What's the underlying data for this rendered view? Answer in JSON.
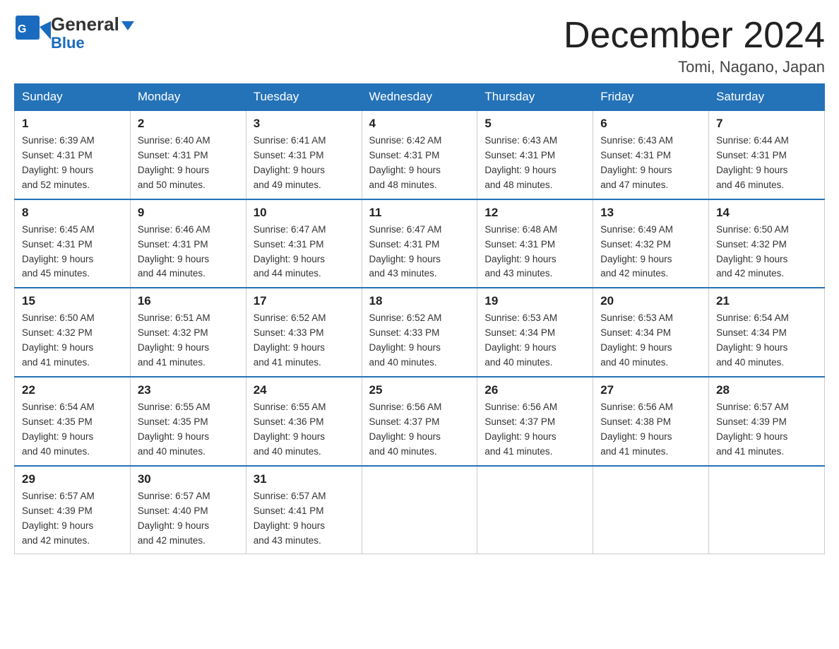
{
  "header": {
    "logo_general": "General",
    "logo_blue": "Blue",
    "month_year": "December 2024",
    "location": "Tomi, Nagano, Japan"
  },
  "weekdays": [
    "Sunday",
    "Monday",
    "Tuesday",
    "Wednesday",
    "Thursday",
    "Friday",
    "Saturday"
  ],
  "weeks": [
    [
      {
        "day": "1",
        "sunrise": "Sunrise: 6:39 AM",
        "sunset": "Sunset: 4:31 PM",
        "daylight": "Daylight: 9 hours",
        "daylight2": "and 52 minutes."
      },
      {
        "day": "2",
        "sunrise": "Sunrise: 6:40 AM",
        "sunset": "Sunset: 4:31 PM",
        "daylight": "Daylight: 9 hours",
        "daylight2": "and 50 minutes."
      },
      {
        "day": "3",
        "sunrise": "Sunrise: 6:41 AM",
        "sunset": "Sunset: 4:31 PM",
        "daylight": "Daylight: 9 hours",
        "daylight2": "and 49 minutes."
      },
      {
        "day": "4",
        "sunrise": "Sunrise: 6:42 AM",
        "sunset": "Sunset: 4:31 PM",
        "daylight": "Daylight: 9 hours",
        "daylight2": "and 48 minutes."
      },
      {
        "day": "5",
        "sunrise": "Sunrise: 6:43 AM",
        "sunset": "Sunset: 4:31 PM",
        "daylight": "Daylight: 9 hours",
        "daylight2": "and 48 minutes."
      },
      {
        "day": "6",
        "sunrise": "Sunrise: 6:43 AM",
        "sunset": "Sunset: 4:31 PM",
        "daylight": "Daylight: 9 hours",
        "daylight2": "and 47 minutes."
      },
      {
        "day": "7",
        "sunrise": "Sunrise: 6:44 AM",
        "sunset": "Sunset: 4:31 PM",
        "daylight": "Daylight: 9 hours",
        "daylight2": "and 46 minutes."
      }
    ],
    [
      {
        "day": "8",
        "sunrise": "Sunrise: 6:45 AM",
        "sunset": "Sunset: 4:31 PM",
        "daylight": "Daylight: 9 hours",
        "daylight2": "and 45 minutes."
      },
      {
        "day": "9",
        "sunrise": "Sunrise: 6:46 AM",
        "sunset": "Sunset: 4:31 PM",
        "daylight": "Daylight: 9 hours",
        "daylight2": "and 44 minutes."
      },
      {
        "day": "10",
        "sunrise": "Sunrise: 6:47 AM",
        "sunset": "Sunset: 4:31 PM",
        "daylight": "Daylight: 9 hours",
        "daylight2": "and 44 minutes."
      },
      {
        "day": "11",
        "sunrise": "Sunrise: 6:47 AM",
        "sunset": "Sunset: 4:31 PM",
        "daylight": "Daylight: 9 hours",
        "daylight2": "and 43 minutes."
      },
      {
        "day": "12",
        "sunrise": "Sunrise: 6:48 AM",
        "sunset": "Sunset: 4:31 PM",
        "daylight": "Daylight: 9 hours",
        "daylight2": "and 43 minutes."
      },
      {
        "day": "13",
        "sunrise": "Sunrise: 6:49 AM",
        "sunset": "Sunset: 4:32 PM",
        "daylight": "Daylight: 9 hours",
        "daylight2": "and 42 minutes."
      },
      {
        "day": "14",
        "sunrise": "Sunrise: 6:50 AM",
        "sunset": "Sunset: 4:32 PM",
        "daylight": "Daylight: 9 hours",
        "daylight2": "and 42 minutes."
      }
    ],
    [
      {
        "day": "15",
        "sunrise": "Sunrise: 6:50 AM",
        "sunset": "Sunset: 4:32 PM",
        "daylight": "Daylight: 9 hours",
        "daylight2": "and 41 minutes."
      },
      {
        "day": "16",
        "sunrise": "Sunrise: 6:51 AM",
        "sunset": "Sunset: 4:32 PM",
        "daylight": "Daylight: 9 hours",
        "daylight2": "and 41 minutes."
      },
      {
        "day": "17",
        "sunrise": "Sunrise: 6:52 AM",
        "sunset": "Sunset: 4:33 PM",
        "daylight": "Daylight: 9 hours",
        "daylight2": "and 41 minutes."
      },
      {
        "day": "18",
        "sunrise": "Sunrise: 6:52 AM",
        "sunset": "Sunset: 4:33 PM",
        "daylight": "Daylight: 9 hours",
        "daylight2": "and 40 minutes."
      },
      {
        "day": "19",
        "sunrise": "Sunrise: 6:53 AM",
        "sunset": "Sunset: 4:34 PM",
        "daylight": "Daylight: 9 hours",
        "daylight2": "and 40 minutes."
      },
      {
        "day": "20",
        "sunrise": "Sunrise: 6:53 AM",
        "sunset": "Sunset: 4:34 PM",
        "daylight": "Daylight: 9 hours",
        "daylight2": "and 40 minutes."
      },
      {
        "day": "21",
        "sunrise": "Sunrise: 6:54 AM",
        "sunset": "Sunset: 4:34 PM",
        "daylight": "Daylight: 9 hours",
        "daylight2": "and 40 minutes."
      }
    ],
    [
      {
        "day": "22",
        "sunrise": "Sunrise: 6:54 AM",
        "sunset": "Sunset: 4:35 PM",
        "daylight": "Daylight: 9 hours",
        "daylight2": "and 40 minutes."
      },
      {
        "day": "23",
        "sunrise": "Sunrise: 6:55 AM",
        "sunset": "Sunset: 4:35 PM",
        "daylight": "Daylight: 9 hours",
        "daylight2": "and 40 minutes."
      },
      {
        "day": "24",
        "sunrise": "Sunrise: 6:55 AM",
        "sunset": "Sunset: 4:36 PM",
        "daylight": "Daylight: 9 hours",
        "daylight2": "and 40 minutes."
      },
      {
        "day": "25",
        "sunrise": "Sunrise: 6:56 AM",
        "sunset": "Sunset: 4:37 PM",
        "daylight": "Daylight: 9 hours",
        "daylight2": "and 40 minutes."
      },
      {
        "day": "26",
        "sunrise": "Sunrise: 6:56 AM",
        "sunset": "Sunset: 4:37 PM",
        "daylight": "Daylight: 9 hours",
        "daylight2": "and 41 minutes."
      },
      {
        "day": "27",
        "sunrise": "Sunrise: 6:56 AM",
        "sunset": "Sunset: 4:38 PM",
        "daylight": "Daylight: 9 hours",
        "daylight2": "and 41 minutes."
      },
      {
        "day": "28",
        "sunrise": "Sunrise: 6:57 AM",
        "sunset": "Sunset: 4:39 PM",
        "daylight": "Daylight: 9 hours",
        "daylight2": "and 41 minutes."
      }
    ],
    [
      {
        "day": "29",
        "sunrise": "Sunrise: 6:57 AM",
        "sunset": "Sunset: 4:39 PM",
        "daylight": "Daylight: 9 hours",
        "daylight2": "and 42 minutes."
      },
      {
        "day": "30",
        "sunrise": "Sunrise: 6:57 AM",
        "sunset": "Sunset: 4:40 PM",
        "daylight": "Daylight: 9 hours",
        "daylight2": "and 42 minutes."
      },
      {
        "day": "31",
        "sunrise": "Sunrise: 6:57 AM",
        "sunset": "Sunset: 4:41 PM",
        "daylight": "Daylight: 9 hours",
        "daylight2": "and 43 minutes."
      },
      null,
      null,
      null,
      null
    ]
  ]
}
